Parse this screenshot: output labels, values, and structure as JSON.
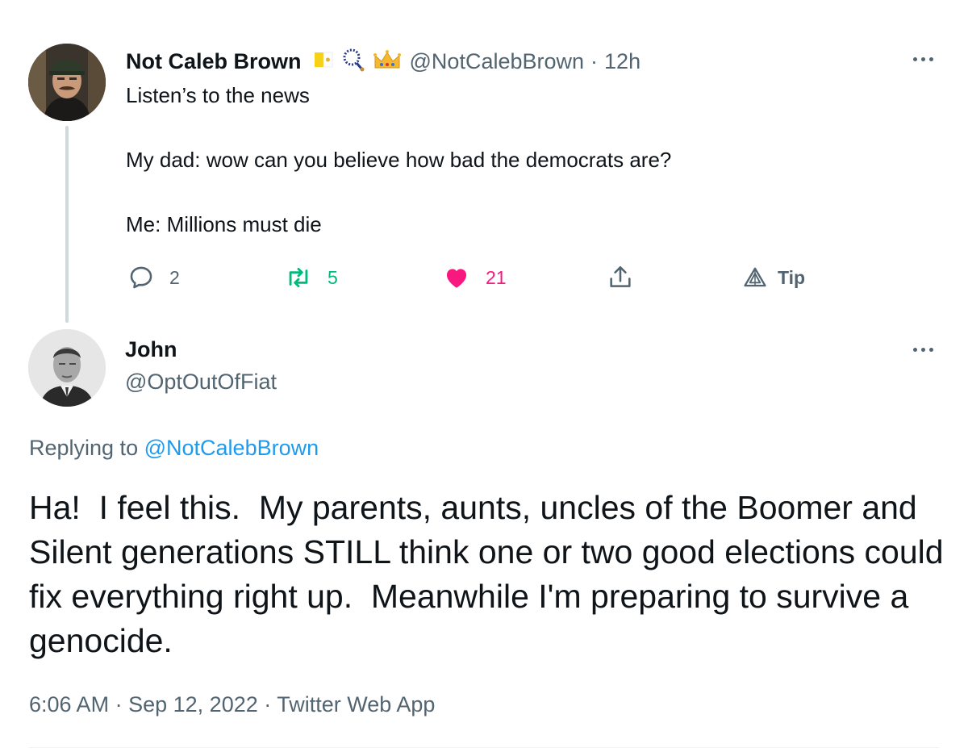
{
  "parent_tweet": {
    "author_name": "Not Caleb Brown",
    "badges": [
      "vatican-flag-icon",
      "rosary-icon",
      "crown-icon"
    ],
    "handle": "@NotCalebBrown",
    "separator": "·",
    "time_ago": "12h",
    "lines": [
      "Listen’s to the news",
      "My dad: wow can you believe how bad the democrats are?",
      "Me: Millions must die"
    ],
    "actions": {
      "reply_count": "2",
      "retweet_count": "5",
      "like_count": "21",
      "tip_label": "Tip"
    }
  },
  "reply_tweet": {
    "author_name": "John",
    "handle": "@OptOutOfFiat",
    "replying_prefix": "Replying to",
    "replying_to": "@NotCalebBrown",
    "text": "Ha!  I feel this.  My parents, aunts, uncles of the Boomer and Silent generations STILL think one or two good elections could fix everything right up.  Meanwhile I'm preparing to survive a genocide.",
    "time": "6:06 AM",
    "date": "Sep 12, 2022",
    "source": "Twitter Web App",
    "meta_separator": "·"
  },
  "colors": {
    "text": "#0f1419",
    "secondary": "#536471",
    "link": "#1d9bf0",
    "retweet_green": "#00ba7c",
    "like_pink": "#f91880"
  }
}
